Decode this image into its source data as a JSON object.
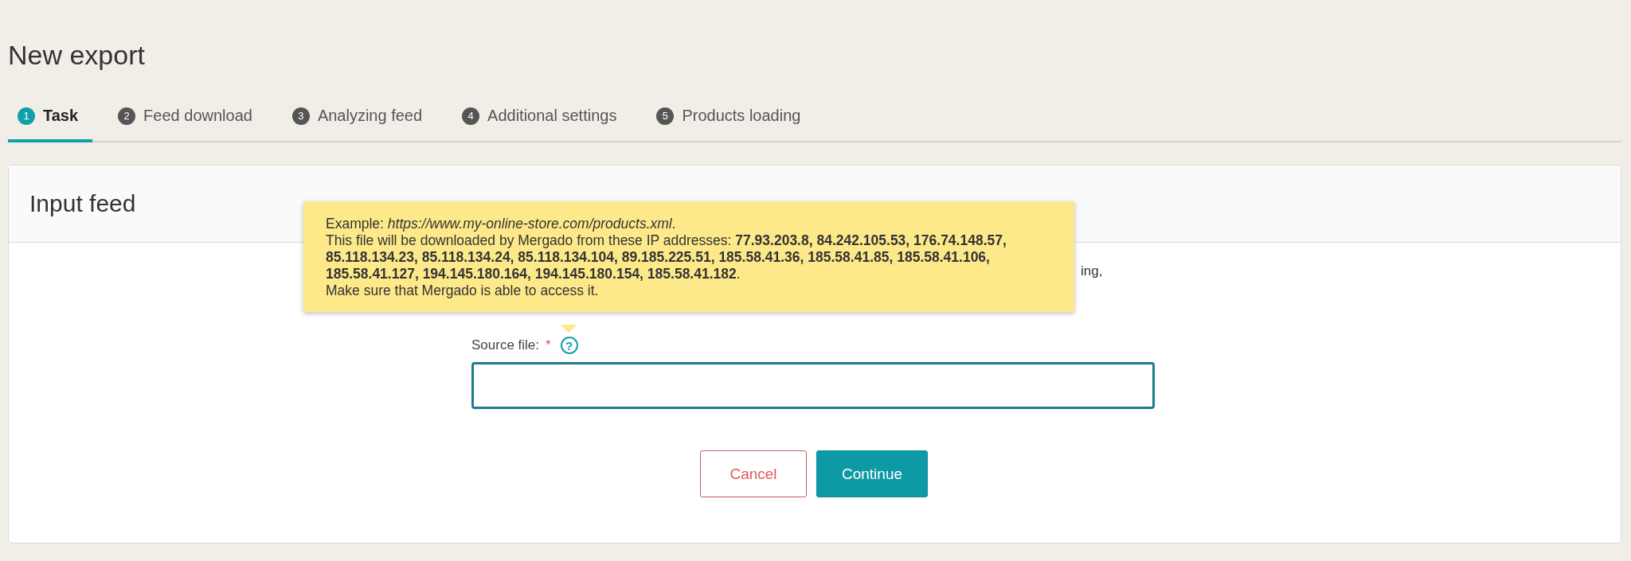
{
  "page_title": "New export",
  "steps": [
    {
      "number": "1",
      "label": "Task",
      "selected": true
    },
    {
      "number": "2",
      "label": "Feed download",
      "selected": false
    },
    {
      "number": "3",
      "label": "Analyzing feed",
      "selected": false
    },
    {
      "number": "4",
      "label": "Additional settings",
      "selected": false
    },
    {
      "number": "5",
      "label": "Products loading",
      "selected": false
    }
  ],
  "card": {
    "title": "Input feed",
    "partial_text": "ing,",
    "tooltip": {
      "lines": [
        "Example: *https://www.my-online-store.com/products.xml*.",
        "This file will be downloaded by Mergado from these IP addresses: **77.93.203.8, 84.242.105.53, 176.74.148.57, 85.118.134.23, 85.118.134.24, 85.118.134.104, 89.185.225.51, 185.58.41.36, 185.58.41.85, 185.58.41.106, 185.58.41.127, 194.145.180.164, 194.145.180.154, 185.58.41.182**.",
        "Make sure that Mergado is able to access it."
      ]
    },
    "field": {
      "label": "Source file:",
      "required_mark": "*",
      "help": "?"
    },
    "buttons": [
      {
        "label": "Cancel",
        "kind": "secondary"
      },
      {
        "label": "Continue",
        "kind": "primary"
      }
    ]
  }
}
